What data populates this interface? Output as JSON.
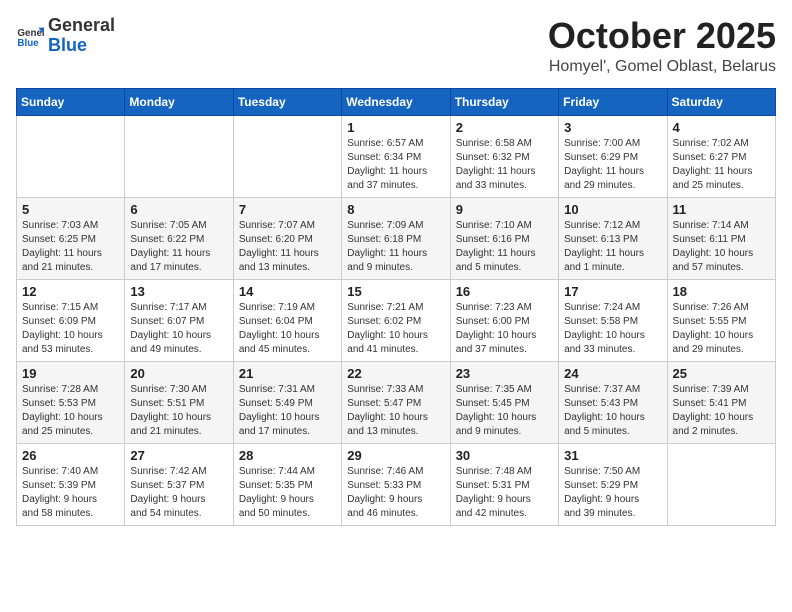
{
  "logo": {
    "text_general": "General",
    "text_blue": "Blue"
  },
  "header": {
    "month_year": "October 2025",
    "location": "Homyel', Gomel Oblast, Belarus"
  },
  "days_of_week": [
    "Sunday",
    "Monday",
    "Tuesday",
    "Wednesday",
    "Thursday",
    "Friday",
    "Saturday"
  ],
  "weeks": [
    [
      {
        "day": "",
        "info": ""
      },
      {
        "day": "",
        "info": ""
      },
      {
        "day": "",
        "info": ""
      },
      {
        "day": "1",
        "info": "Sunrise: 6:57 AM\nSunset: 6:34 PM\nDaylight: 11 hours\nand 37 minutes."
      },
      {
        "day": "2",
        "info": "Sunrise: 6:58 AM\nSunset: 6:32 PM\nDaylight: 11 hours\nand 33 minutes."
      },
      {
        "day": "3",
        "info": "Sunrise: 7:00 AM\nSunset: 6:29 PM\nDaylight: 11 hours\nand 29 minutes."
      },
      {
        "day": "4",
        "info": "Sunrise: 7:02 AM\nSunset: 6:27 PM\nDaylight: 11 hours\nand 25 minutes."
      }
    ],
    [
      {
        "day": "5",
        "info": "Sunrise: 7:03 AM\nSunset: 6:25 PM\nDaylight: 11 hours\nand 21 minutes."
      },
      {
        "day": "6",
        "info": "Sunrise: 7:05 AM\nSunset: 6:22 PM\nDaylight: 11 hours\nand 17 minutes."
      },
      {
        "day": "7",
        "info": "Sunrise: 7:07 AM\nSunset: 6:20 PM\nDaylight: 11 hours\nand 13 minutes."
      },
      {
        "day": "8",
        "info": "Sunrise: 7:09 AM\nSunset: 6:18 PM\nDaylight: 11 hours\nand 9 minutes."
      },
      {
        "day": "9",
        "info": "Sunrise: 7:10 AM\nSunset: 6:16 PM\nDaylight: 11 hours\nand 5 minutes."
      },
      {
        "day": "10",
        "info": "Sunrise: 7:12 AM\nSunset: 6:13 PM\nDaylight: 11 hours\nand 1 minute."
      },
      {
        "day": "11",
        "info": "Sunrise: 7:14 AM\nSunset: 6:11 PM\nDaylight: 10 hours\nand 57 minutes."
      }
    ],
    [
      {
        "day": "12",
        "info": "Sunrise: 7:15 AM\nSunset: 6:09 PM\nDaylight: 10 hours\nand 53 minutes."
      },
      {
        "day": "13",
        "info": "Sunrise: 7:17 AM\nSunset: 6:07 PM\nDaylight: 10 hours\nand 49 minutes."
      },
      {
        "day": "14",
        "info": "Sunrise: 7:19 AM\nSunset: 6:04 PM\nDaylight: 10 hours\nand 45 minutes."
      },
      {
        "day": "15",
        "info": "Sunrise: 7:21 AM\nSunset: 6:02 PM\nDaylight: 10 hours\nand 41 minutes."
      },
      {
        "day": "16",
        "info": "Sunrise: 7:23 AM\nSunset: 6:00 PM\nDaylight: 10 hours\nand 37 minutes."
      },
      {
        "day": "17",
        "info": "Sunrise: 7:24 AM\nSunset: 5:58 PM\nDaylight: 10 hours\nand 33 minutes."
      },
      {
        "day": "18",
        "info": "Sunrise: 7:26 AM\nSunset: 5:55 PM\nDaylight: 10 hours\nand 29 minutes."
      }
    ],
    [
      {
        "day": "19",
        "info": "Sunrise: 7:28 AM\nSunset: 5:53 PM\nDaylight: 10 hours\nand 25 minutes."
      },
      {
        "day": "20",
        "info": "Sunrise: 7:30 AM\nSunset: 5:51 PM\nDaylight: 10 hours\nand 21 minutes."
      },
      {
        "day": "21",
        "info": "Sunrise: 7:31 AM\nSunset: 5:49 PM\nDaylight: 10 hours\nand 17 minutes."
      },
      {
        "day": "22",
        "info": "Sunrise: 7:33 AM\nSunset: 5:47 PM\nDaylight: 10 hours\nand 13 minutes."
      },
      {
        "day": "23",
        "info": "Sunrise: 7:35 AM\nSunset: 5:45 PM\nDaylight: 10 hours\nand 9 minutes."
      },
      {
        "day": "24",
        "info": "Sunrise: 7:37 AM\nSunset: 5:43 PM\nDaylight: 10 hours\nand 5 minutes."
      },
      {
        "day": "25",
        "info": "Sunrise: 7:39 AM\nSunset: 5:41 PM\nDaylight: 10 hours\nand 2 minutes."
      }
    ],
    [
      {
        "day": "26",
        "info": "Sunrise: 7:40 AM\nSunset: 5:39 PM\nDaylight: 9 hours\nand 58 minutes."
      },
      {
        "day": "27",
        "info": "Sunrise: 7:42 AM\nSunset: 5:37 PM\nDaylight: 9 hours\nand 54 minutes."
      },
      {
        "day": "28",
        "info": "Sunrise: 7:44 AM\nSunset: 5:35 PM\nDaylight: 9 hours\nand 50 minutes."
      },
      {
        "day": "29",
        "info": "Sunrise: 7:46 AM\nSunset: 5:33 PM\nDaylight: 9 hours\nand 46 minutes."
      },
      {
        "day": "30",
        "info": "Sunrise: 7:48 AM\nSunset: 5:31 PM\nDaylight: 9 hours\nand 42 minutes."
      },
      {
        "day": "31",
        "info": "Sunrise: 7:50 AM\nSunset: 5:29 PM\nDaylight: 9 hours\nand 39 minutes."
      },
      {
        "day": "",
        "info": ""
      }
    ]
  ]
}
